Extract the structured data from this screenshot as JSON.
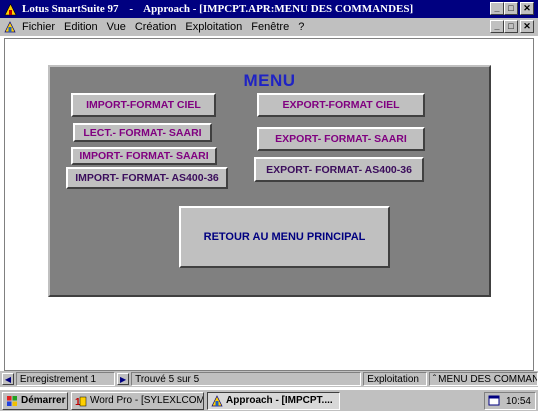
{
  "window": {
    "app_name": "Lotus SmartSuite 97",
    "title_sep": "-",
    "title_doc": "Approach - [IMPCPT.APR:MENU DES COMMANDES]",
    "buttons": [
      "_",
      "3",
      "×"
    ]
  },
  "menubar": {
    "items": [
      "Fichier",
      "Edition",
      "Vue",
      "Création",
      "Exploitation",
      "Fenêtre",
      "?"
    ],
    "mdi_buttons": [
      "_",
      "3",
      "×"
    ]
  },
  "form": {
    "title": "MENU",
    "buttons": {
      "import_ciel": "IMPORT-FORMAT CIEL",
      "export_ciel": "EXPORT-FORMAT CIEL",
      "lect_saari": "LECT.- FORMAT- SAARI",
      "export_saari": "EXPORT- FORMAT- SAARI",
      "import_saari": "IMPORT- FORMAT- SAARI",
      "export_as400": "EXPORT- FORMAT- AS400-36",
      "import_as400": "IMPORT- FORMAT- AS400-36",
      "retour": "RETOUR AU MENU PRINCIPAL"
    }
  },
  "statusbar": {
    "record": "Enregistrement 1",
    "found": "Trouvé 5 sur 5",
    "mode": "Exploitation",
    "view": "MENU DES COMMANDE"
  },
  "taskbar": {
    "start": "Démarrer",
    "tasks": [
      "Word Pro - [SYLEXLCOM...",
      "Approach - [IMPCPT...."
    ],
    "clock": "10:54"
  },
  "colors": {
    "title_bar": "#000080",
    "panel": "#808080",
    "menu_title": "#1f23c4",
    "button_text": "#800080"
  }
}
